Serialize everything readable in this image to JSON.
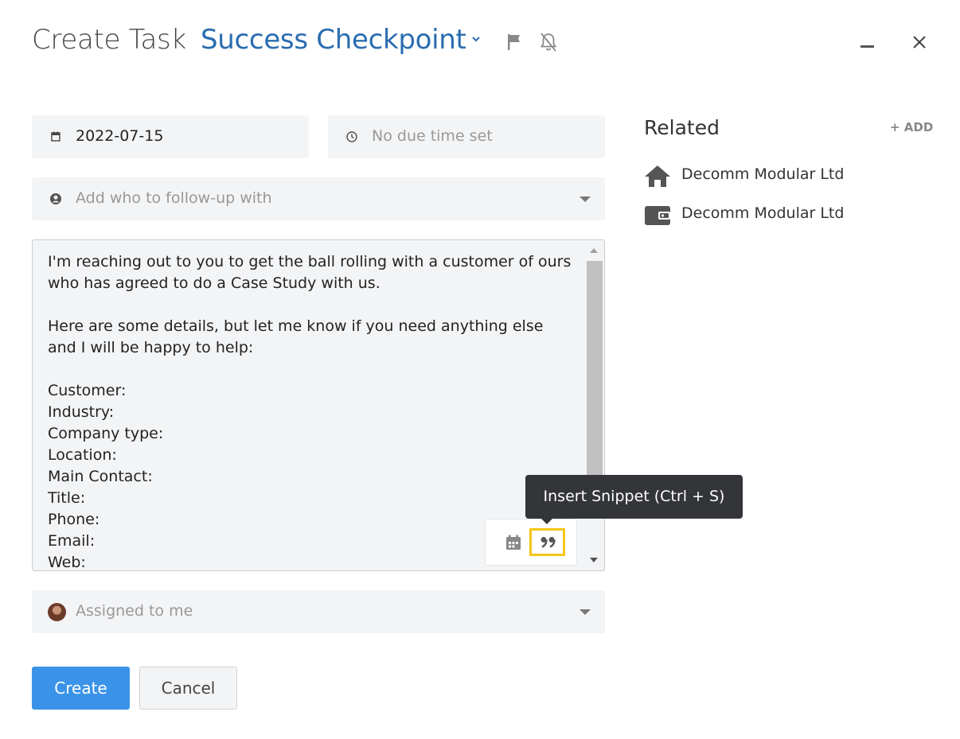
{
  "header": {
    "title_static": "Create Task",
    "task_type": "Success Checkpoint",
    "icons": [
      "chevron-down-icon",
      "flag-icon",
      "bell-off-icon",
      "minimize-icon",
      "close-icon"
    ]
  },
  "form": {
    "date": {
      "value": "2022-07-15",
      "icon": "calendar-icon"
    },
    "time": {
      "placeholder": "No due time set",
      "icon": "clock-icon"
    },
    "followup": {
      "placeholder": "Add who to follow-up with",
      "icon": "person-icon"
    },
    "note_text": "I'm reaching out to you to get the ball rolling with a customer of ours who has agreed to do a Case Study with us.\n\nHere are some details, but let me know if you need anything else and I will be happy to help:\n\nCustomer:\nIndustry:\nCompany type:\nLocation:\nMain Contact:\nTitle:\nPhone:\nEmail:\nWeb:",
    "editor_tools": [
      "calendar-icon",
      "quote-icon"
    ],
    "tooltip": "Insert Snippet (Ctrl + S)",
    "assigned": {
      "value": "Assigned to me",
      "icon": "avatar"
    }
  },
  "buttons": {
    "create": "Create",
    "cancel": "Cancel"
  },
  "related": {
    "title": "Related",
    "add_label": "+ ADD",
    "items": [
      {
        "label": "Decomm Modular Ltd",
        "icon": "home-icon"
      },
      {
        "label": "Decomm Modular Ltd",
        "icon": "wallet-icon"
      }
    ]
  },
  "colors": {
    "accent": "#2a6cb0",
    "primary_button": "#3a93e8",
    "highlight": "#f5c518",
    "tooltip_bg": "#333538"
  }
}
